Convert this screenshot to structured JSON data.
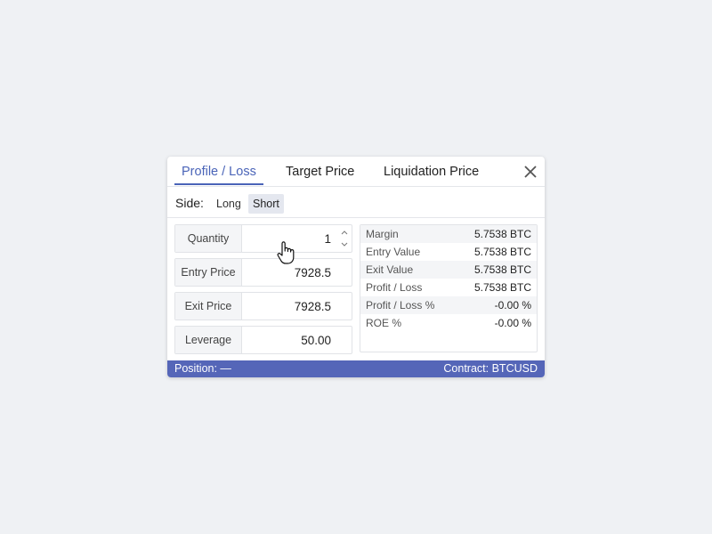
{
  "tabs": [
    {
      "label": "Profile / Loss",
      "active": true
    },
    {
      "label": "Target Price",
      "active": false
    },
    {
      "label": "Liquidation Price",
      "active": false
    }
  ],
  "close_icon": "close-icon",
  "side": {
    "label": "Side:",
    "options": [
      "Long",
      "Short"
    ],
    "selected": "Short"
  },
  "fields": {
    "quantity": {
      "label": "Quantity",
      "value": "1"
    },
    "entry_price": {
      "label": "Entry Price",
      "value": "7928.5"
    },
    "exit_price": {
      "label": "Exit Price",
      "value": "7928.5"
    },
    "leverage": {
      "label": "Leverage",
      "value": "50.00"
    }
  },
  "results": [
    {
      "label": "Margin",
      "value": "5.7538 BTC"
    },
    {
      "label": "Entry Value",
      "value": "5.7538 BTC"
    },
    {
      "label": "Exit Value",
      "value": "5.7538 BTC"
    },
    {
      "label": "Profit / Loss",
      "value": "5.7538 BTC"
    },
    {
      "label": "Profit / Loss %",
      "value": "-0.00 %"
    },
    {
      "label": "ROE %",
      "value": "-0.00 %"
    }
  ],
  "footer": {
    "position": "Position: —",
    "contract": "Contract: BTCUSD"
  },
  "colors": {
    "accent": "#4a64b8",
    "footer_bg": "#5566b8",
    "page_bg": "#eff1f4"
  }
}
